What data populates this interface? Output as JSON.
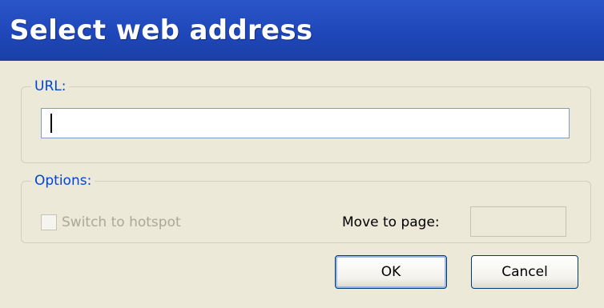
{
  "window": {
    "title": "Select web address"
  },
  "url_group": {
    "legend": "URL:",
    "value": ""
  },
  "options_group": {
    "legend": "Options:",
    "hotspot_label": "Switch to hotspot",
    "hotspot_checked": false,
    "move_to_page_label": "Move to page:",
    "move_to_page_value": ""
  },
  "buttons": {
    "ok": "OK",
    "cancel": "Cancel"
  },
  "colors": {
    "titlebar": "#1f47b9",
    "dialog_bg": "#ece9d8",
    "legend": "#0046d5",
    "disabled_text": "#aca899"
  }
}
